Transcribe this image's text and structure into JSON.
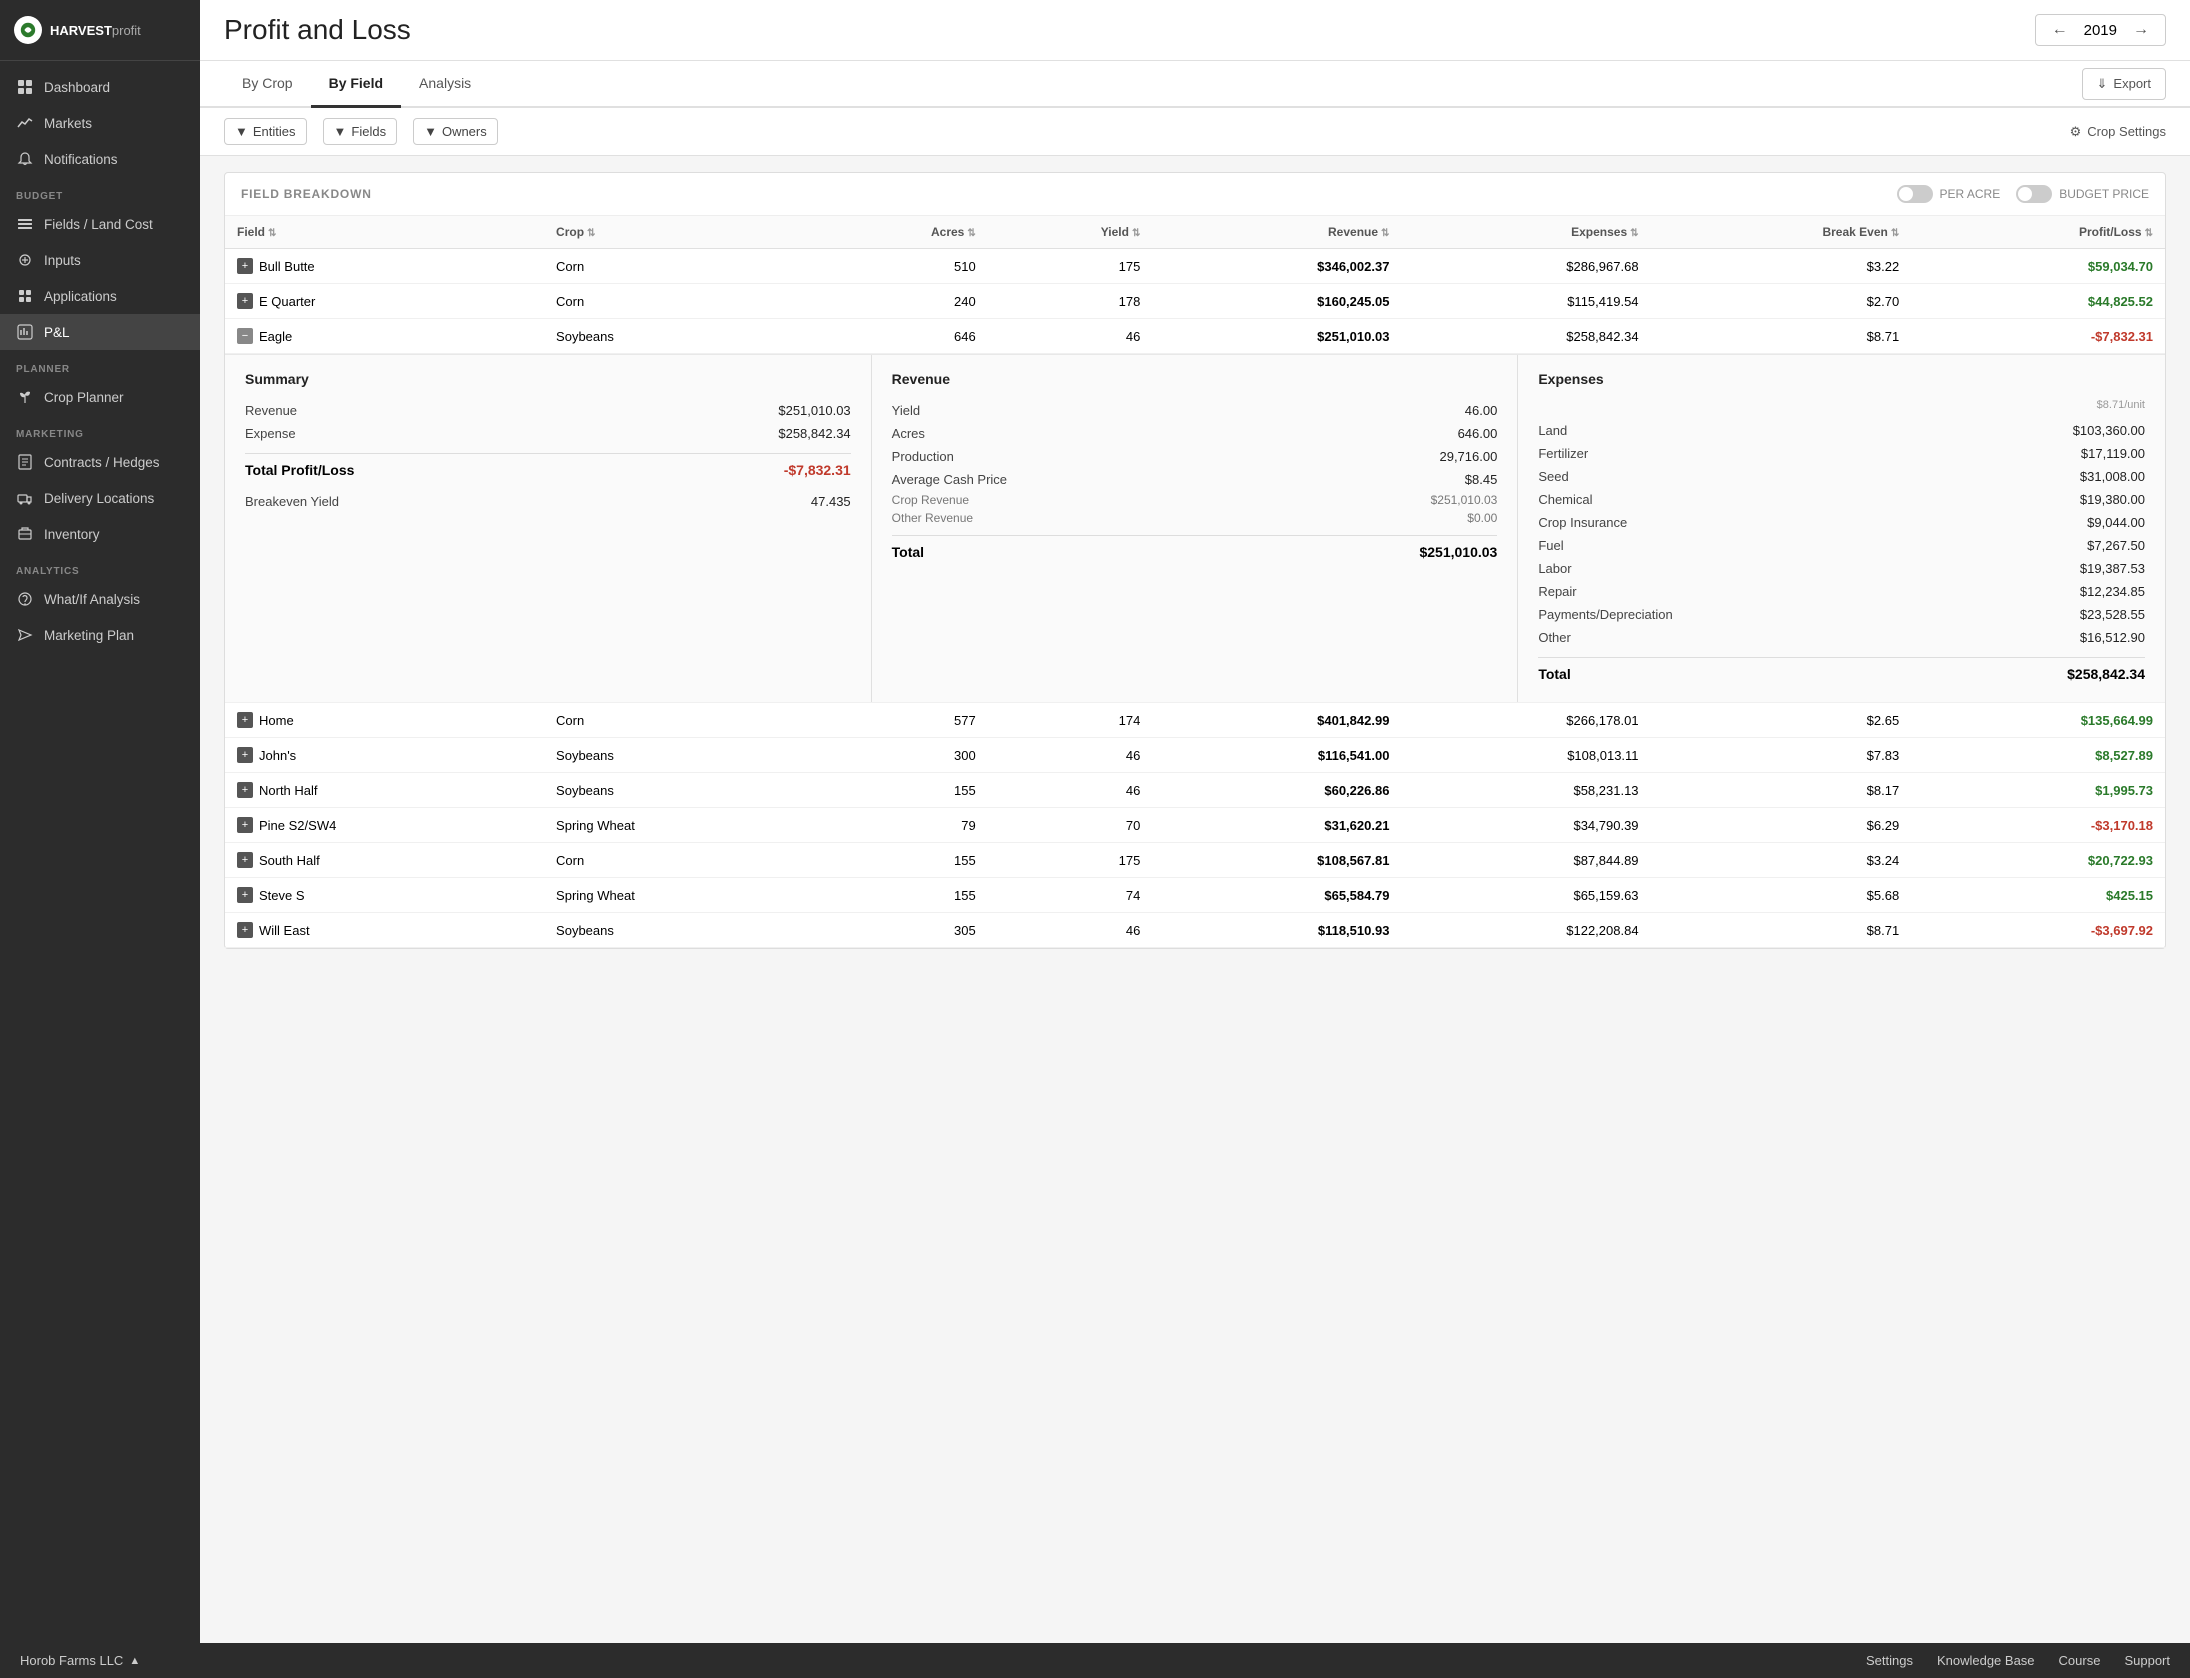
{
  "app": {
    "name": "HARVEST",
    "name_suffix": "profit",
    "current_year": "2019"
  },
  "sidebar": {
    "nav_items": [
      {
        "id": "dashboard",
        "label": "Dashboard",
        "icon": "dashboard"
      },
      {
        "id": "markets",
        "label": "Markets",
        "icon": "markets"
      },
      {
        "id": "notifications",
        "label": "Notifications",
        "icon": "notifications"
      }
    ],
    "budget_section": "BUDGET",
    "budget_items": [
      {
        "id": "fields",
        "label": "Fields / Land Cost",
        "icon": "fields"
      },
      {
        "id": "inputs",
        "label": "Inputs",
        "icon": "inputs"
      },
      {
        "id": "applications",
        "label": "Applications",
        "icon": "applications"
      },
      {
        "id": "pl",
        "label": "P&L",
        "icon": "pl",
        "active": true
      }
    ],
    "planner_section": "PLANNER",
    "planner_items": [
      {
        "id": "crop",
        "label": "Crop Planner",
        "icon": "crop"
      }
    ],
    "marketing_section": "MARKETING",
    "marketing_items": [
      {
        "id": "contracts",
        "label": "Contracts / Hedges",
        "icon": "contracts"
      },
      {
        "id": "delivery",
        "label": "Delivery Locations",
        "icon": "delivery"
      },
      {
        "id": "inventory",
        "label": "Inventory",
        "icon": "inventory"
      }
    ],
    "analytics_section": "ANALYTICS",
    "analytics_items": [
      {
        "id": "whatif",
        "label": "What/If Analysis",
        "icon": "whatif"
      },
      {
        "id": "marketing",
        "label": "Marketing Plan",
        "icon": "marketing"
      }
    ]
  },
  "page": {
    "title": "Profit and Loss"
  },
  "tabs": [
    {
      "id": "by-crop",
      "label": "By Crop"
    },
    {
      "id": "by-field",
      "label": "By Field",
      "active": true
    },
    {
      "id": "analysis",
      "label": "Analysis"
    }
  ],
  "export_label": "Export",
  "filters": {
    "entities_label": "Entities",
    "fields_label": "Fields",
    "owners_label": "Owners",
    "crop_settings_label": "Crop Settings"
  },
  "field_breakdown": {
    "title": "FIELD BREAKDOWN",
    "per_acre_label": "PER ACRE",
    "budget_price_label": "BUDGET PRICE",
    "columns": [
      {
        "id": "field",
        "label": "Field"
      },
      {
        "id": "crop",
        "label": "Crop"
      },
      {
        "id": "acres",
        "label": "Acres"
      },
      {
        "id": "yield",
        "label": "Yield"
      },
      {
        "id": "revenue",
        "label": "Revenue"
      },
      {
        "id": "expenses",
        "label": "Expenses"
      },
      {
        "id": "break_even",
        "label": "Break Even"
      },
      {
        "id": "profit_loss",
        "label": "Profit/Loss"
      }
    ],
    "rows": [
      {
        "field": "Bull Butte",
        "crop": "Corn",
        "acres": "510",
        "yield": "175",
        "revenue": "$346,002.37",
        "expenses": "$286,967.68",
        "break_even": "$3.22",
        "profit_loss": "$59,034.70",
        "positive": true,
        "expanded": false
      },
      {
        "field": "E Quarter",
        "crop": "Corn",
        "acres": "240",
        "yield": "178",
        "revenue": "$160,245.05",
        "expenses": "$115,419.54",
        "break_even": "$2.70",
        "profit_loss": "$44,825.52",
        "positive": true,
        "expanded": false
      },
      {
        "field": "Eagle",
        "crop": "Soybeans",
        "acres": "646",
        "yield": "46",
        "revenue": "$251,010.03",
        "expenses": "$258,842.34",
        "break_even": "$8.71",
        "profit_loss": "-$7,832.31",
        "positive": false,
        "expanded": true
      },
      {
        "field": "Home",
        "crop": "Corn",
        "acres": "577",
        "yield": "174",
        "revenue": "$401,842.99",
        "expenses": "$266,178.01",
        "break_even": "$2.65",
        "profit_loss": "$135,664.99",
        "positive": true,
        "expanded": false
      },
      {
        "field": "John's",
        "crop": "Soybeans",
        "acres": "300",
        "yield": "46",
        "revenue": "$116,541.00",
        "expenses": "$108,013.11",
        "break_even": "$7.83",
        "profit_loss": "$8,527.89",
        "positive": true,
        "expanded": false
      },
      {
        "field": "North Half",
        "crop": "Soybeans",
        "acres": "155",
        "yield": "46",
        "revenue": "$60,226.86",
        "expenses": "$58,231.13",
        "break_even": "$8.17",
        "profit_loss": "$1,995.73",
        "positive": true,
        "expanded": false
      },
      {
        "field": "Pine S2/SW4",
        "crop": "Spring Wheat",
        "acres": "79",
        "yield": "70",
        "revenue": "$31,620.21",
        "expenses": "$34,790.39",
        "break_even": "$6.29",
        "profit_loss": "-$3,170.18",
        "positive": false,
        "expanded": false
      },
      {
        "field": "South Half",
        "crop": "Corn",
        "acres": "155",
        "yield": "175",
        "revenue": "$108,567.81",
        "expenses": "$87,844.89",
        "break_even": "$3.24",
        "profit_loss": "$20,722.93",
        "positive": true,
        "expanded": false
      },
      {
        "field": "Steve S",
        "crop": "Spring Wheat",
        "acres": "155",
        "yield": "74",
        "revenue": "$65,584.79",
        "expenses": "$65,159.63",
        "break_even": "$5.68",
        "profit_loss": "$425.15",
        "positive": true,
        "expanded": false
      },
      {
        "field": "Will East",
        "crop": "Soybeans",
        "acres": "305",
        "yield": "46",
        "revenue": "$118,510.93",
        "expenses": "$122,208.84",
        "break_even": "$8.71",
        "profit_loss": "-$3,697.92",
        "positive": false,
        "expanded": false
      }
    ],
    "eagle_summary": {
      "title": "Summary",
      "revenue_label": "Revenue",
      "revenue_value": "$251,010.03",
      "expense_label": "Expense",
      "expense_value": "$258,842.34",
      "total_pl_label": "Total Profit/Loss",
      "total_pl_value": "-$7,832.31",
      "breakeven_yield_label": "Breakeven Yield",
      "breakeven_yield_value": "47.435"
    },
    "eagle_revenue": {
      "title": "Revenue",
      "yield_label": "Yield",
      "yield_value": "46.00",
      "acres_label": "Acres",
      "acres_value": "646.00",
      "production_label": "Production",
      "production_value": "29,716.00",
      "avg_cash_price_label": "Average Cash Price",
      "avg_cash_price_value": "$8.45",
      "crop_revenue_label": "Crop Revenue",
      "crop_revenue_value": "$251,010.03",
      "other_revenue_label": "Other Revenue",
      "other_revenue_value": "$0.00",
      "total_label": "Total",
      "total_value": "$251,010.03"
    },
    "eagle_expenses": {
      "title": "Expenses",
      "unit_label": "$8.71/unit",
      "land_label": "Land",
      "land_value": "$103,360.00",
      "fertilizer_label": "Fertilizer",
      "fertilizer_value": "$17,119.00",
      "seed_label": "Seed",
      "seed_value": "$31,008.00",
      "chemical_label": "Chemical",
      "chemical_value": "$19,380.00",
      "crop_insurance_label": "Crop Insurance",
      "crop_insurance_value": "$9,044.00",
      "fuel_label": "Fuel",
      "fuel_value": "$7,267.50",
      "labor_label": "Labor",
      "labor_value": "$19,387.53",
      "repair_label": "Repair",
      "repair_value": "$12,234.85",
      "payments_depreciation_label": "Payments/Depreciation",
      "payments_depreciation_value": "$23,528.55",
      "other_label": "Other",
      "other_value": "$16,512.90",
      "total_label": "Total",
      "total_value": "$258,842.34"
    }
  },
  "bottom_bar": {
    "org_name": "Horob Farms LLC",
    "settings_label": "Settings",
    "knowledge_base_label": "Knowledge Base",
    "course_label": "Course",
    "support_label": "Support"
  }
}
